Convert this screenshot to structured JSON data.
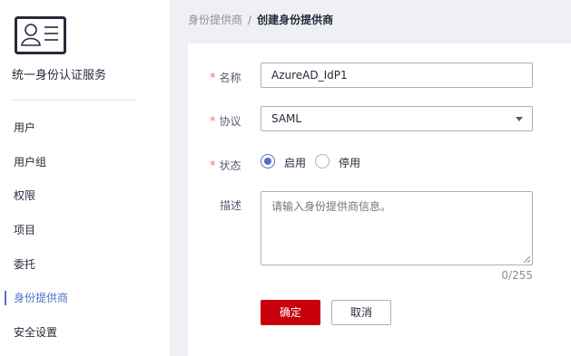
{
  "sidebar": {
    "service_title": "统一身份认证服务",
    "items": [
      {
        "label": "用户",
        "active": false
      },
      {
        "label": "用户组",
        "active": false
      },
      {
        "label": "权限",
        "active": false
      },
      {
        "label": "项目",
        "active": false
      },
      {
        "label": "委托",
        "active": false
      },
      {
        "label": "身份提供商",
        "active": true
      },
      {
        "label": "安全设置",
        "active": false
      }
    ]
  },
  "breadcrumb": {
    "parent": "身份提供商",
    "separator": "/",
    "current": "创建身份提供商"
  },
  "form": {
    "required_mark": "*",
    "name_label": "名称",
    "name_value": "AzureAD_IdP1",
    "protocol_label": "协议",
    "protocol_value": "SAML",
    "status_label": "状态",
    "status_enabled": "启用",
    "status_disabled": "停用",
    "status_selected": "启用",
    "description_label": "描述",
    "description_placeholder": "请输入身份提供商信息。",
    "description_counter": "0/255",
    "confirm_label": "确定",
    "cancel_label": "取消"
  },
  "colors": {
    "accent": "#526ecc",
    "primary_button": "#c7000b",
    "required": "#f66f6a"
  },
  "icons": {
    "logo": "id-card-icon",
    "protocol_dropdown": "caret-down-icon",
    "textarea_resize": "resize-grip-icon"
  }
}
